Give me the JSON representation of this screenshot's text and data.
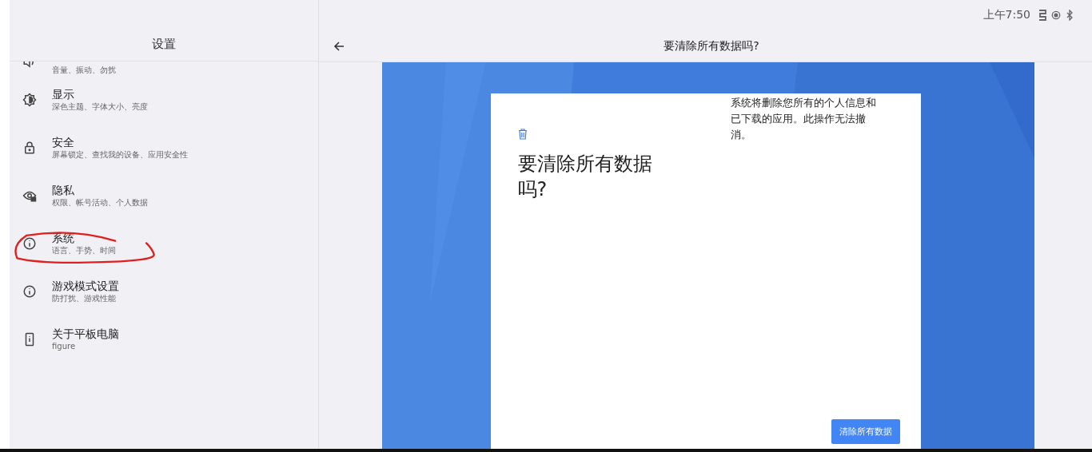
{
  "status_bar": {
    "time": "上午7:50"
  },
  "sidebar": {
    "title": "设置",
    "items": [
      {
        "subtitle": "音量、振动、勿扰",
        "selected": false
      },
      {
        "title": "显示",
        "subtitle": "深色主题、字体大小、亮度",
        "selected": false
      },
      {
        "title": "安全",
        "subtitle": "屏幕锁定、查找我的设备、应用安全性",
        "selected": false
      },
      {
        "title": "隐私",
        "subtitle": "权限、帐号活动、个人数据",
        "selected": false
      },
      {
        "title": "系统",
        "subtitle": "语言、手势、时间",
        "selected": false
      },
      {
        "title": "游戏模式设置",
        "subtitle": "防打扰、游戏性能",
        "selected": false
      },
      {
        "title": "关于平板电脑",
        "subtitle": "figure",
        "selected": false
      }
    ]
  },
  "detail": {
    "title": "要清除所有数据吗?",
    "card": {
      "heading": "要清除所有数据吗?",
      "description": "系统将删除您所有的个人信息和已下载的应用。此操作无法撤消。",
      "button": "清除所有数据"
    }
  }
}
